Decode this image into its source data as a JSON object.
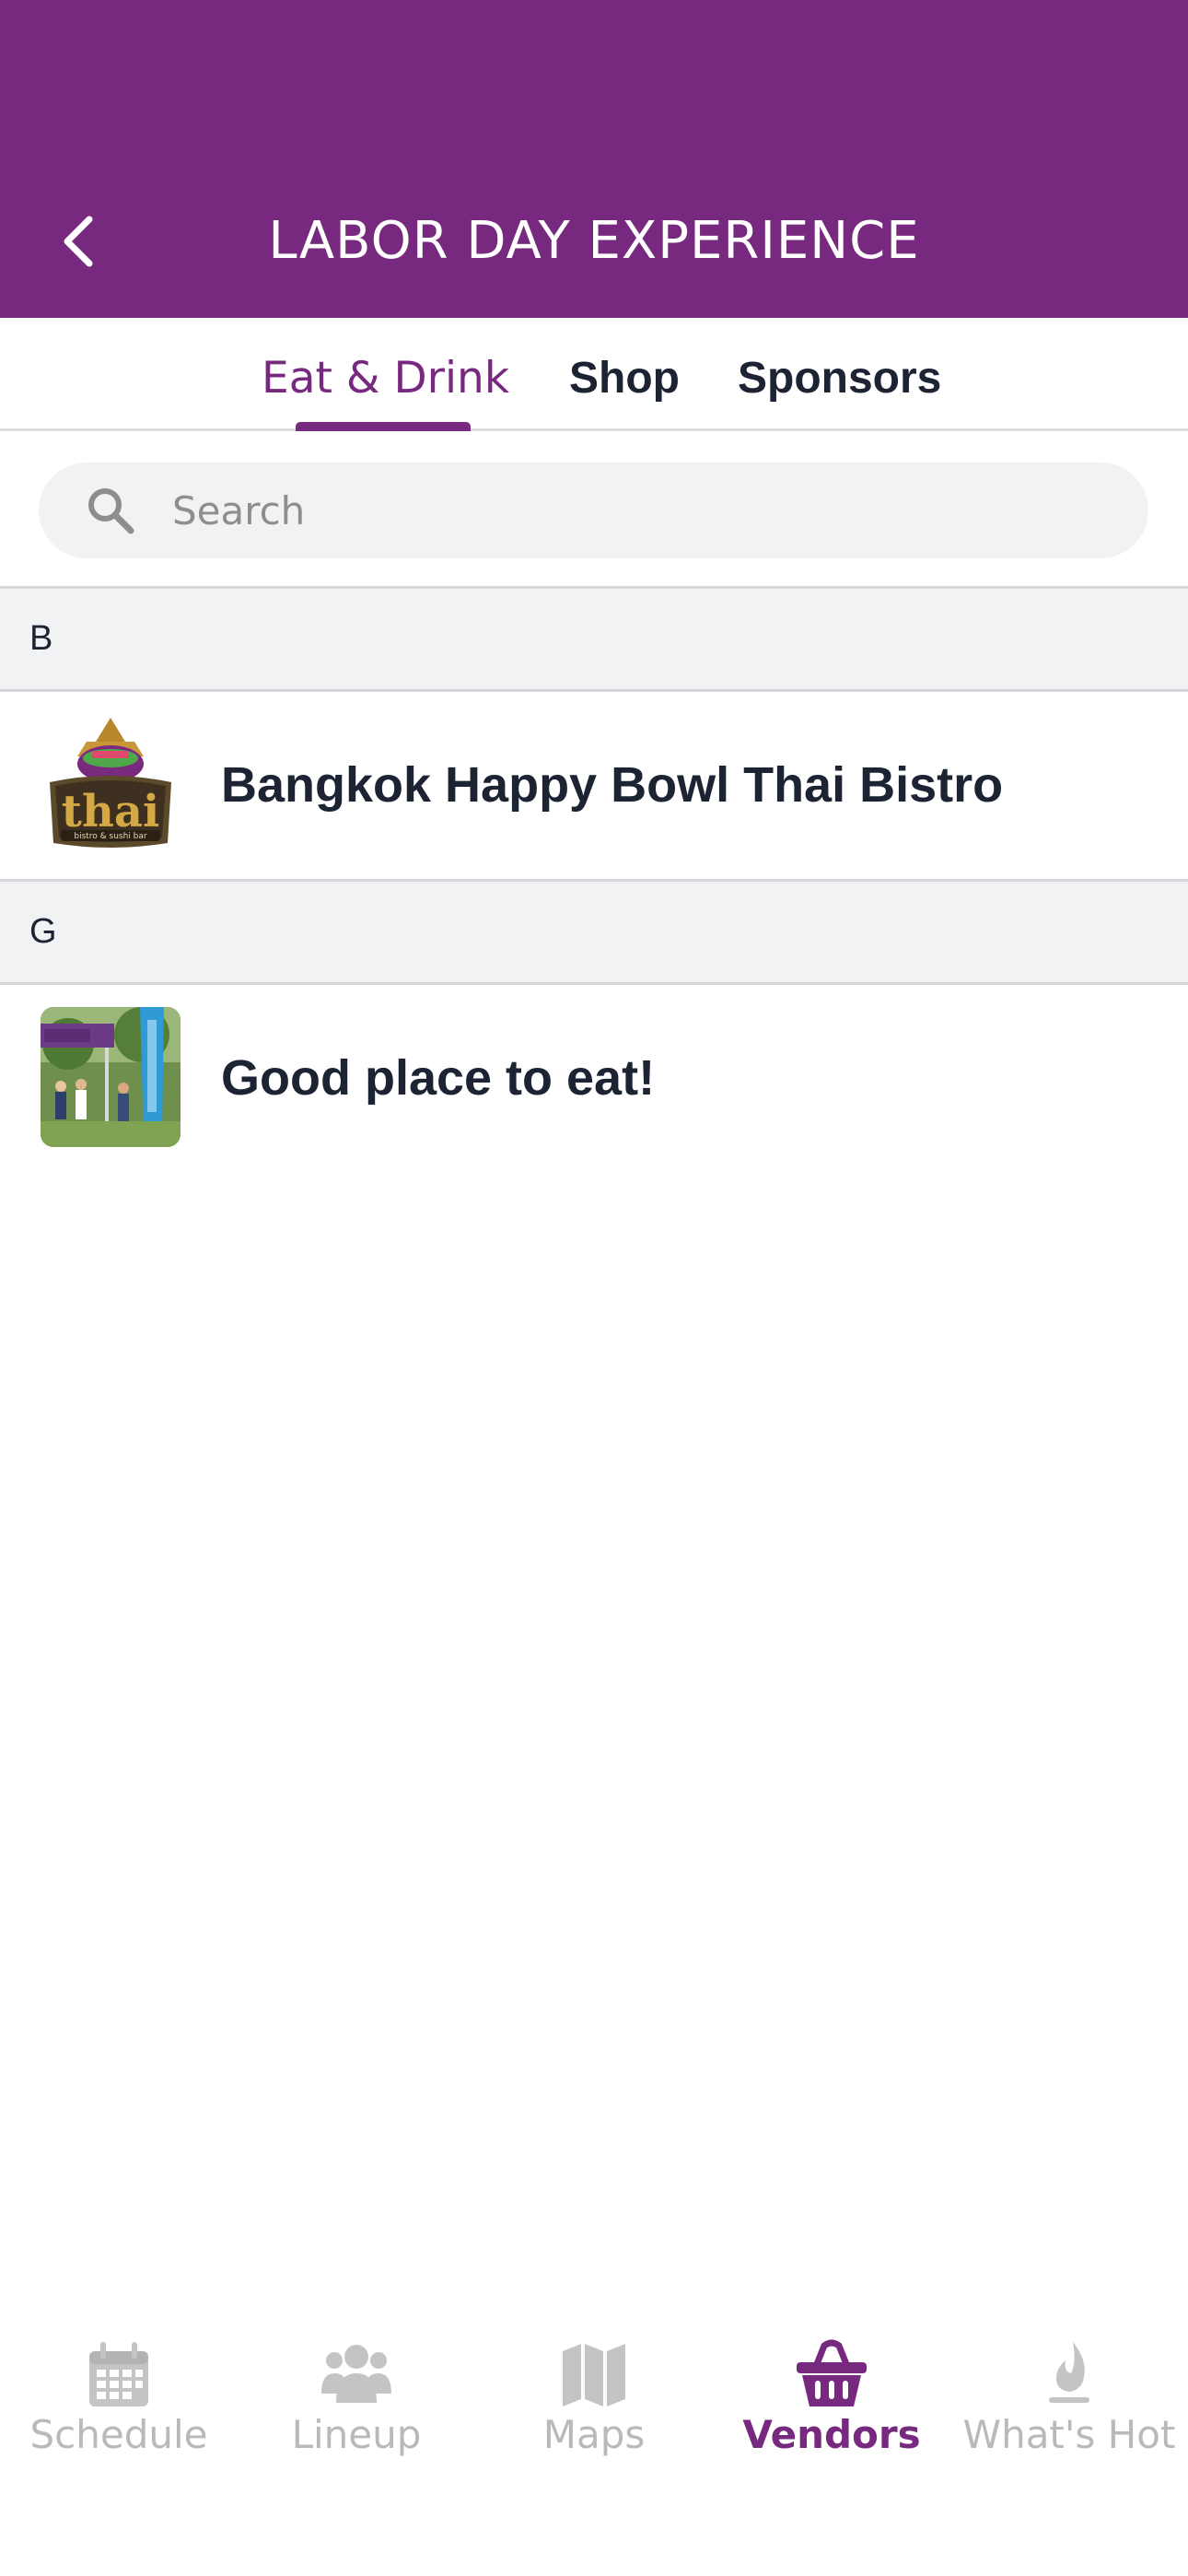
{
  "header": {
    "title": "LABOR DAY EXPERIENCE",
    "background_color": "#77297f"
  },
  "tabs": [
    {
      "label": "Eat & Drink",
      "active": true
    },
    {
      "label": "Shop",
      "active": false
    },
    {
      "label": "Sponsors",
      "active": false
    }
  ],
  "search": {
    "placeholder": "Search",
    "value": ""
  },
  "sections": [
    {
      "letter": "B",
      "vendors": [
        {
          "name": "Bangkok Happy Bowl Thai Bistro",
          "thumbnail": "thai-bistro-logo"
        }
      ]
    },
    {
      "letter": "G",
      "vendors": [
        {
          "name": "Good place to eat!",
          "thumbnail": "event-photo"
        }
      ]
    }
  ],
  "bottom_nav": [
    {
      "label": "Schedule",
      "icon": "calendar-icon",
      "active": false
    },
    {
      "label": "Lineup",
      "icon": "people-icon",
      "active": false
    },
    {
      "label": "Maps",
      "icon": "map-icon",
      "active": false
    },
    {
      "label": "Vendors",
      "icon": "basket-icon",
      "active": true
    },
    {
      "label": "What's Hot",
      "icon": "flame-icon",
      "active": false
    }
  ],
  "colors": {
    "accent": "#77297f",
    "inactive_nav": "#b9b9b9",
    "text_dark": "#1c2333",
    "section_bg": "#f1f2f4"
  }
}
